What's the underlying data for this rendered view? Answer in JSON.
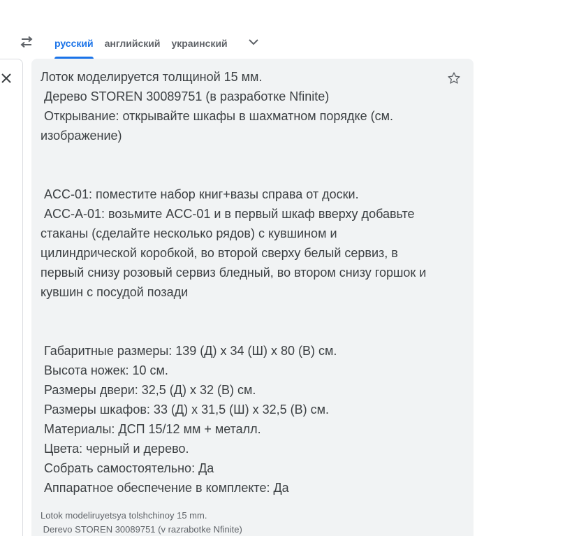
{
  "language_bar": {
    "tabs": [
      {
        "label": "русский",
        "active": true
      },
      {
        "label": "английский",
        "active": false
      },
      {
        "label": "украинский",
        "active": false
      }
    ],
    "swap_icon": "swap-arrows-icon",
    "dropdown_icon": "chevron-down-icon"
  },
  "source": {
    "clear_icon": "close-icon"
  },
  "target": {
    "translation": "Лоток моделируется толщиной 15 мм.\n Дерево STOREN 30089751 (в разработке Nfinite)\n Открывание: открывайте шкафы в шахматном порядке (см. изображение)\n\n\n ACC-01: поместите набор книг+вазы справа от доски.\n ACC-A-01: возьмите ACC-01 и в первый шкаф вверху добавьте стаканы (сделайте несколько рядов) с кувшином и цилиндрической коробкой, во второй сверху белый сервиз, в первый снизу розовый сервиз бледный, во втором снизу горшок и кувшин с посудой позади\n\n\n Габаритные размеры: 139 (Д) x 34 (Ш) x 80 (В) см.\n Высота ножек: 10 см.\n Размеры двери: 32,5 (Д) x 32 (В) см.\n Размеры шкафов: 33 (Д) x 31,5 (Ш) x 32,5 (В) см.\n Материалы: ДСП 15/12 мм + металл.\n Цвета: черный и дерево.\n Собрать самостоятельно: Да\n Аппаратное обеспечение в комплекте: Да",
    "transliteration": "Lotok modeliruyetsya tolshchinoy 15 mm.\n Derevo STOREN 30089751 (v razrabotke Nfinite)",
    "star_icon": "star-outline-icon"
  },
  "colors": {
    "accent": "#1a73e8",
    "tab_inactive": "#5f6368",
    "panel_bg": "#f1f3f4",
    "text": "#3c4043"
  }
}
